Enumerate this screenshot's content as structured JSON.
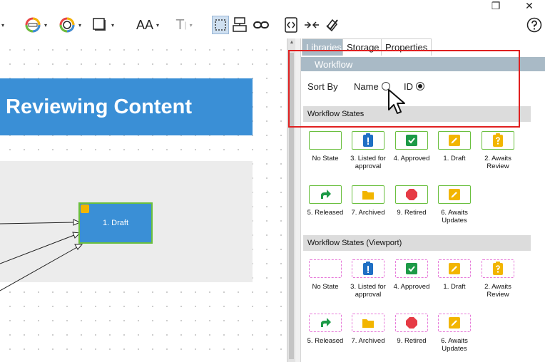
{
  "window": {
    "restore_glyph": "❐",
    "close_glyph": "✕"
  },
  "toolbar": {
    "font_size_label": "AA",
    "text_label": "T"
  },
  "canvas": {
    "title": "Reviewing Content",
    "draft_node_label": "1. Draft"
  },
  "panel": {
    "tabs": [
      {
        "label": "Libraries",
        "active": true
      },
      {
        "label": "Storage",
        "active": false
      },
      {
        "label": "Properties",
        "active": false
      }
    ],
    "section_title": "Workflow",
    "sort_by_label": "Sort By",
    "sort_options": [
      {
        "label": "Name",
        "selected": false
      },
      {
        "label": "ID",
        "selected": true
      }
    ],
    "groups": [
      {
        "title": "Workflow States",
        "items": [
          {
            "label": "No State",
            "icon": "empty"
          },
          {
            "label": "3. Listed for approval",
            "icon": "listed"
          },
          {
            "label": "4. Approved",
            "icon": "approved"
          },
          {
            "label": "1. Draft",
            "icon": "draft"
          },
          {
            "label": "2. Awaits Review",
            "icon": "review"
          },
          {
            "label": "5. Released",
            "icon": "released"
          },
          {
            "label": "7. Archived",
            "icon": "archived"
          },
          {
            "label": "9. Retired",
            "icon": "retired"
          },
          {
            "label": "6. Awaits Updates",
            "icon": "updates"
          }
        ]
      },
      {
        "title": "Workflow States (Viewport)",
        "items": [
          {
            "label": "No State",
            "icon": "empty"
          },
          {
            "label": "3. Listed for approval",
            "icon": "listed"
          },
          {
            "label": "4. Approved",
            "icon": "approved"
          },
          {
            "label": "1. Draft",
            "icon": "draft"
          },
          {
            "label": "2. Awaits Review",
            "icon": "review"
          },
          {
            "label": "5. Released",
            "icon": "released"
          },
          {
            "label": "7. Archived",
            "icon": "archived"
          },
          {
            "label": "9. Retired",
            "icon": "retired"
          },
          {
            "label": "6. Awaits Updates",
            "icon": "updates"
          }
        ]
      }
    ]
  },
  "colors": {
    "accent_blue": "#3a8fd6",
    "state_green": "#6abf3e",
    "panel_header": "#a9bac6",
    "highlight_red": "#e02020",
    "viewport_pink": "#e77ad9"
  }
}
